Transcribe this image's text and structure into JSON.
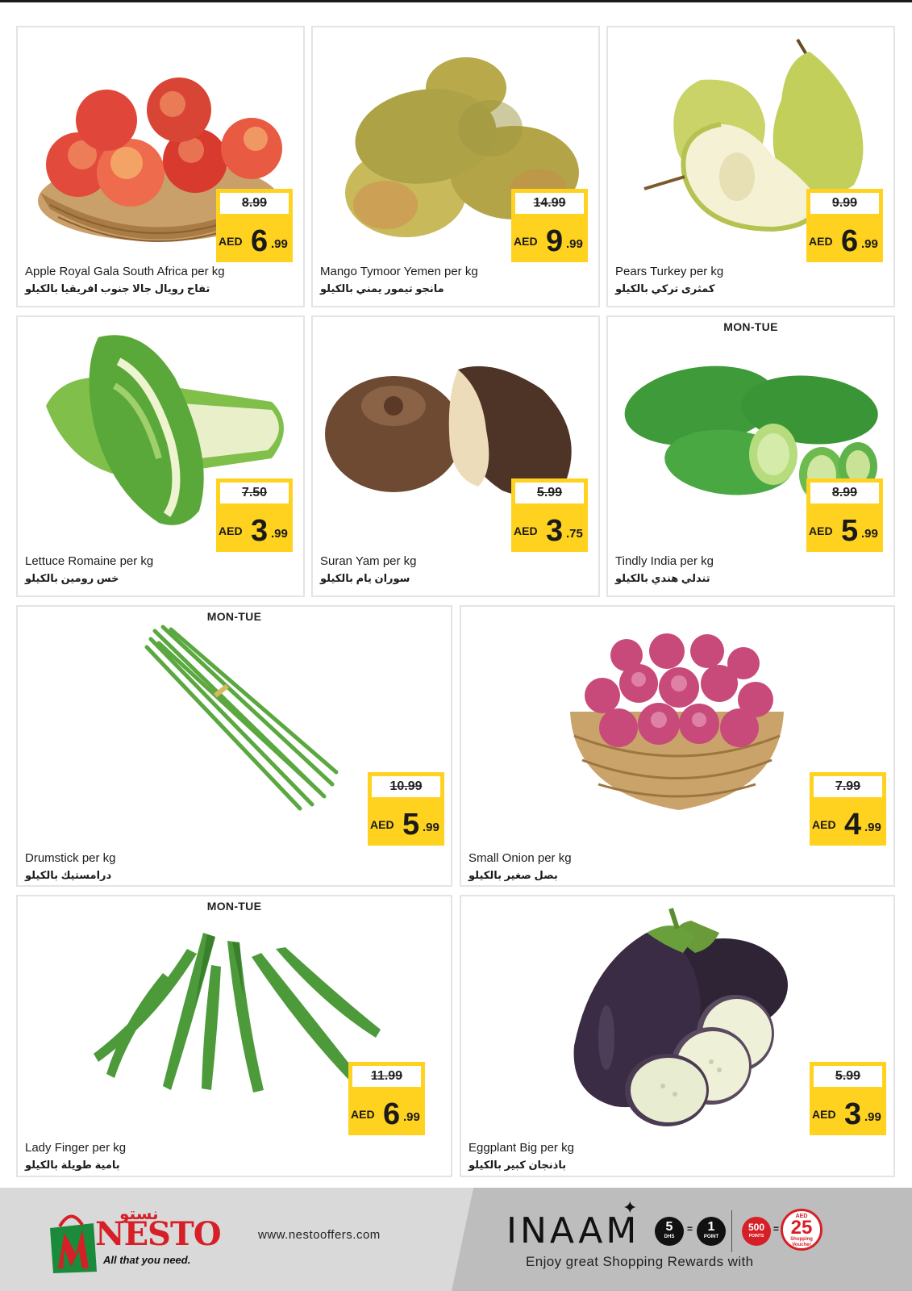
{
  "currency": "AED",
  "products": [
    {
      "name_en": "Apple Royal Gala South Africa per kg",
      "name_ar": "تفاح رويال جالا جنوب افريقيا بالكيلو",
      "old_price": "8.99",
      "price_int": "6",
      "price_dec": ".99",
      "day_tag": ""
    },
    {
      "name_en": "Mango Tymoor Yemen per kg",
      "name_ar": "مانجو تيمور يمني بالكيلو",
      "old_price": "14.99",
      "price_int": "9",
      "price_dec": ".99",
      "day_tag": ""
    },
    {
      "name_en": "Pears Turkey per kg",
      "name_ar": "كمثرى تركي بالكيلو",
      "old_price": "9.99",
      "price_int": "6",
      "price_dec": ".99",
      "day_tag": ""
    },
    {
      "name_en": "Lettuce Romaine per kg",
      "name_ar": "خس رومين بالكيلو",
      "old_price": "7.50",
      "price_int": "3",
      "price_dec": ".99",
      "day_tag": ""
    },
    {
      "name_en": "Suran Yam per kg",
      "name_ar": "سوران يام بالكيلو",
      "old_price": "5.99",
      "price_int": "3",
      "price_dec": ".75",
      "day_tag": ""
    },
    {
      "name_en": "Tindly India per kg",
      "name_ar": "تندلي هندي بالكيلو",
      "old_price": "8.99",
      "price_int": "5",
      "price_dec": ".99",
      "day_tag": "MON-TUE"
    },
    {
      "name_en": "Drumstick per kg",
      "name_ar": "درامستيك بالكيلو",
      "old_price": "10.99",
      "price_int": "5",
      "price_dec": ".99",
      "day_tag": "MON-TUE"
    },
    {
      "name_en": "Small Onion per kg",
      "name_ar": "بصل صغير بالكيلو",
      "old_price": "7.99",
      "price_int": "4",
      "price_dec": ".99",
      "day_tag": ""
    },
    {
      "name_en": "Lady Finger per kg",
      "name_ar": "بامية طويلة بالكيلو",
      "old_price": "11.99",
      "price_int": "6",
      "price_dec": ".99",
      "day_tag": "MON-TUE"
    },
    {
      "name_en": "Eggplant Big per kg",
      "name_ar": "باذنجان كبير بالكيلو",
      "old_price": "5.99",
      "price_int": "3",
      "price_dec": ".99",
      "day_tag": ""
    }
  ],
  "footer": {
    "logo_ar": "نستو",
    "logo_text": "NESTO",
    "tagline": "All that you need.",
    "website": "www.nestooffers.com",
    "inaam_title": "INAAM",
    "inaam_subtitle": "Enjoy great Shopping Rewards with",
    "spend_value": "5",
    "spend_label": "DHS",
    "point_value": "1",
    "point_label": "POINT",
    "points_value": "500",
    "points_label": "POINTS",
    "voucher_currency": "AED",
    "voucher_amount": "25",
    "voucher_label": "Shopping Voucher"
  },
  "colors": {
    "price_tag": "#ffd21f",
    "brand_red": "#d61f26",
    "brand_green": "#1b8a3a"
  }
}
